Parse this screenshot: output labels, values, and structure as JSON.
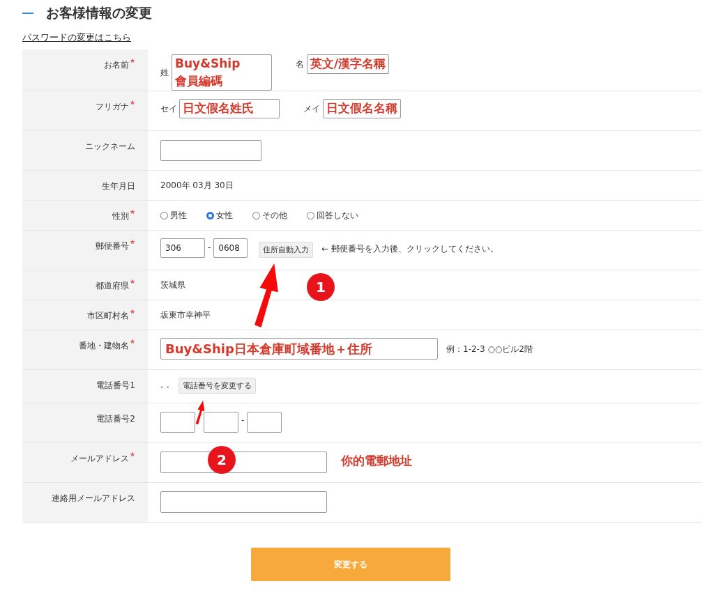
{
  "heading": "お客様情報の変更",
  "password_link": "パスワードの変更はこちら",
  "rows": [
    {
      "kind": "name_pair",
      "label": "お名前",
      "required": true,
      "parts": [
        {
          "prefix": "姓",
          "value": "Buy&Ship 會員編碼"
        },
        {
          "prefix": "名",
          "value": "英文/漢字名稱"
        }
      ]
    },
    {
      "kind": "name_pair",
      "label": "フリガナ",
      "required": true,
      "parts": [
        {
          "prefix": "セイ",
          "value": "日文假名姓氏"
        },
        {
          "prefix": "メイ",
          "value": "日文假名名稱"
        }
      ]
    },
    {
      "kind": "short_input",
      "label": "ニックネーム",
      "required": false
    },
    {
      "kind": "text",
      "label": "生年月日",
      "required": false,
      "text": "2000年 03月 30日"
    },
    {
      "kind": "radio",
      "label": "性別",
      "required": true,
      "options": [
        {
          "label": "男性",
          "selected": false
        },
        {
          "label": "女性",
          "selected": true
        },
        {
          "label": "その他",
          "selected": false
        },
        {
          "label": "回答しない",
          "selected": false
        }
      ]
    },
    {
      "kind": "postal",
      "label": "郵便番号",
      "required": true,
      "first": "306",
      "separator": "-",
      "second": "0608",
      "button": "住所自動入力",
      "hint": "← 郵便番号を入力後、クリックしてください。"
    },
    {
      "kind": "text",
      "label": "都道府県",
      "required": true,
      "text": "茨城県"
    },
    {
      "kind": "text",
      "label": "市区町村名",
      "required": true,
      "text": "坂東市幸神平"
    },
    {
      "kind": "address",
      "label": "番地・建物名",
      "required": true,
      "value": "Buy&Ship日本倉庫町域番地＋住所",
      "hint": "例：1-2-3 ○○ビル2階"
    },
    {
      "kind": "phone_button",
      "label": "電話番号1",
      "required": false,
      "text": "- -",
      "button": "電話番号を変更する"
    },
    {
      "kind": "phone_fields",
      "label": "電話番号2",
      "required": false,
      "separators": [
        "-"
      ]
    },
    {
      "kind": "long_input",
      "label": "メールアドレス",
      "required": true,
      "annotation": "你的電郵地址"
    },
    {
      "kind": "long_input",
      "label": "連絡用メールアドレス",
      "required": false
    }
  ],
  "submit": "変更する",
  "callouts": [
    {
      "number": "1"
    },
    {
      "number": "2"
    }
  ]
}
